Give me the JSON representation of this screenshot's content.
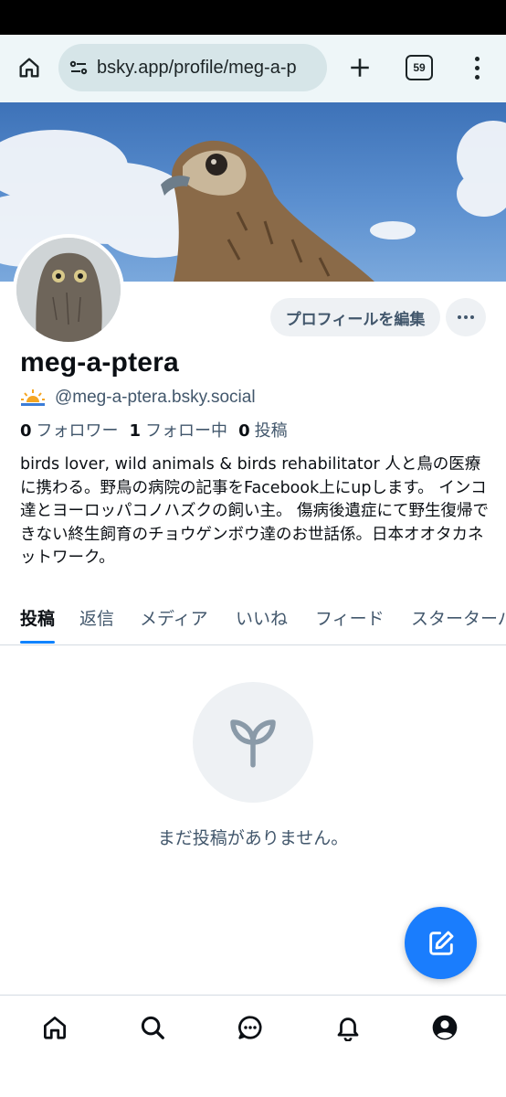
{
  "browser": {
    "url": "bsky.app/profile/meg-a-p",
    "tab_count": "59",
    "icons": [
      "home-icon",
      "site-settings-icon",
      "plus-icon",
      "tabs-icon",
      "more-vert-icon"
    ]
  },
  "profile": {
    "display_name": "meg-a-ptera",
    "handle": "@meg-a-ptera.bsky.social",
    "edit_button": "プロフィールを編集",
    "stats": {
      "followers_count": "0",
      "followers_label": "フォロワー",
      "following_count": "1",
      "following_label": "フォロー中",
      "posts_count": "0",
      "posts_label": "投稿"
    },
    "bio": "birds lover, wild animals & birds rehabilitator 人と鳥の医療に携わる。野鳥の病院の記事をFacebook上にupします。 インコ達とヨーロッパコノハズクの飼い主。 傷病後遺症にて野生復帰できない終生飼育のチョウゲンボウ達のお世話係。日本オオタカネットワーク。"
  },
  "tabs": [
    {
      "label": "投稿",
      "active": true
    },
    {
      "label": "返信",
      "active": false
    },
    {
      "label": "メディア",
      "active": false
    },
    {
      "label": "いいね",
      "active": false
    },
    {
      "label": "フィード",
      "active": false
    },
    {
      "label": "スターターパック",
      "active": false
    }
  ],
  "empty_state": {
    "message": "まだ投稿がありません。",
    "icon": "sprout-icon"
  },
  "bottom_nav": [
    "home-icon",
    "search-icon",
    "chat-icon",
    "bell-icon",
    "profile-icon"
  ],
  "colors": {
    "accent": "#1083fe",
    "fab": "#1a7dfd",
    "secondary_text": "#42576c",
    "browser_bar": "#eef6f8"
  }
}
